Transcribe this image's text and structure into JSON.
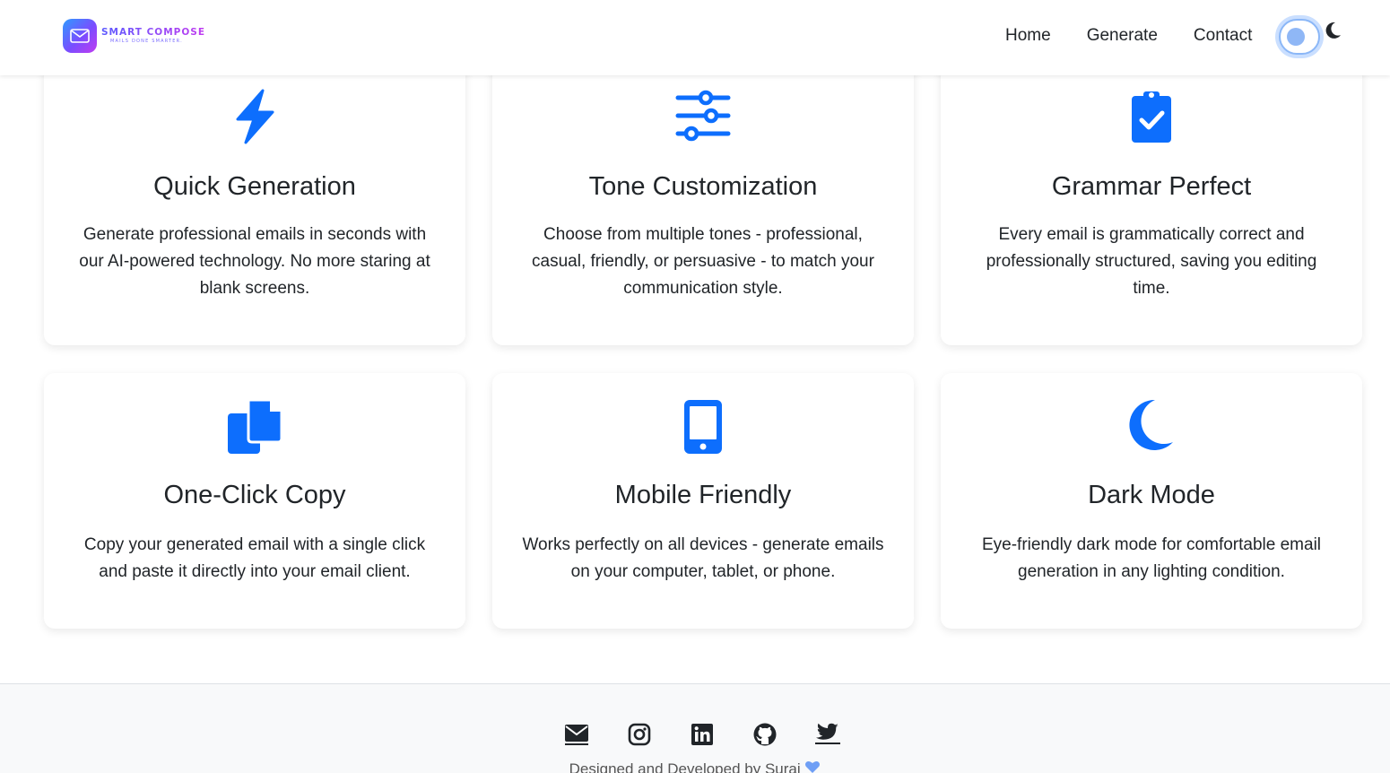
{
  "brand": {
    "name": "SMART COMPOSE",
    "tagline": "MAILS DONE SMARTER."
  },
  "nav": {
    "links": [
      "Home",
      "Generate",
      "Contact"
    ],
    "theme_toggle": "off"
  },
  "features": [
    {
      "icon": "lightning-bolt-icon",
      "title": "Quick Generation",
      "text": "Generate professional emails in seconds with our AI-powered technology. No more staring at blank screens."
    },
    {
      "icon": "sliders-icon",
      "title": "Tone Customization",
      "text": "Choose from multiple tones - professional, casual, friendly, or persuasive - to match your communication style."
    },
    {
      "icon": "clipboard-check-icon",
      "title": "Grammar Perfect",
      "text": "Every email is grammatically correct and professionally structured, saving you editing time."
    },
    {
      "icon": "copy-icon",
      "title": "One-Click Copy",
      "text": "Copy your generated email with a single click and paste it directly into your email client."
    },
    {
      "icon": "mobile-phone-icon",
      "title": "Mobile Friendly",
      "text": "Works perfectly on all devices - generate emails on your computer, tablet, or phone."
    },
    {
      "icon": "moon-icon",
      "title": "Dark Mode",
      "text": "Eye-friendly dark mode for comfortable email generation in any lighting condition."
    }
  ],
  "footer": {
    "social": [
      "envelope-icon",
      "instagram-icon",
      "linkedin-icon",
      "github-icon",
      "twitter-icon"
    ],
    "credit": "Designed and Developed by Suraj"
  },
  "colors": {
    "accent": "#0d6efd",
    "text": "#212529",
    "footer_bg": "#f8f9fa"
  }
}
